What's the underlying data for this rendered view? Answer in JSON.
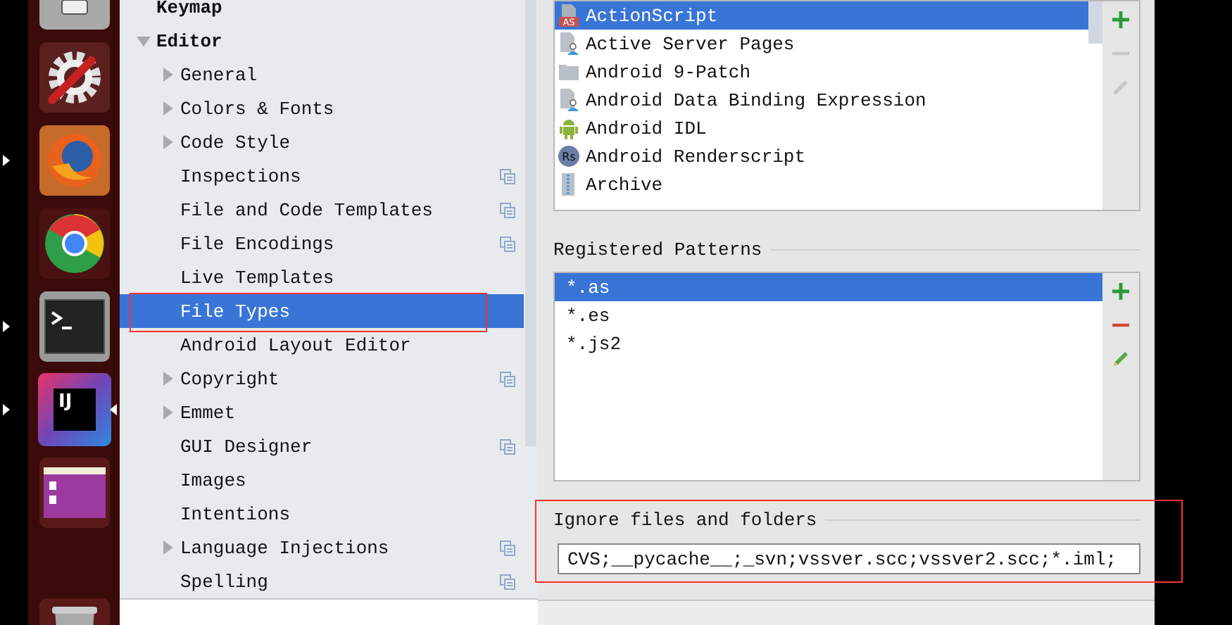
{
  "dock": {
    "items": [
      {
        "kind": "drawer",
        "running": false,
        "focused": false
      },
      {
        "kind": "settings",
        "running": false,
        "focused": false
      },
      {
        "kind": "firefox",
        "running": true,
        "focused": false
      },
      {
        "kind": "chrome",
        "running": false,
        "focused": false
      },
      {
        "kind": "terminal",
        "running": true,
        "focused": false
      },
      {
        "kind": "ide",
        "logo_text": "IJ",
        "running": true,
        "focused": true
      },
      {
        "kind": "files",
        "running": false,
        "focused": false
      },
      {
        "kind": "trash",
        "running": false,
        "focused": false
      }
    ]
  },
  "settings_tree": {
    "items": [
      {
        "label": "Keymap",
        "kind": "leaf",
        "selected": false,
        "project_scoped": false
      },
      {
        "label": "Editor",
        "kind": "branch",
        "expanded": true,
        "selected": false,
        "project_scoped": false,
        "children": [
          {
            "label": "General",
            "kind": "branch",
            "expanded": false,
            "selected": false,
            "project_scoped": false
          },
          {
            "label": "Colors & Fonts",
            "kind": "branch",
            "expanded": false,
            "selected": false,
            "project_scoped": false
          },
          {
            "label": "Code Style",
            "kind": "branch",
            "expanded": false,
            "selected": false,
            "project_scoped": false
          },
          {
            "label": "Inspections",
            "kind": "leaf",
            "selected": false,
            "project_scoped": true
          },
          {
            "label": "File and Code Templates",
            "kind": "leaf",
            "selected": false,
            "project_scoped": true
          },
          {
            "label": "File Encodings",
            "kind": "leaf",
            "selected": false,
            "project_scoped": true
          },
          {
            "label": "Live Templates",
            "kind": "leaf",
            "selected": false,
            "project_scoped": false
          },
          {
            "label": "File Types",
            "kind": "leaf",
            "selected": true,
            "project_scoped": false
          },
          {
            "label": "Android Layout Editor",
            "kind": "leaf",
            "selected": false,
            "project_scoped": false
          },
          {
            "label": "Copyright",
            "kind": "branch",
            "expanded": false,
            "selected": false,
            "project_scoped": true
          },
          {
            "label": "Emmet",
            "kind": "branch",
            "expanded": false,
            "selected": false,
            "project_scoped": false
          },
          {
            "label": "GUI Designer",
            "kind": "leaf",
            "selected": false,
            "project_scoped": true
          },
          {
            "label": "Images",
            "kind": "leaf",
            "selected": false,
            "project_scoped": false
          },
          {
            "label": "Intentions",
            "kind": "leaf",
            "selected": false,
            "project_scoped": false
          },
          {
            "label": "Language Injections",
            "kind": "branch",
            "expanded": false,
            "selected": false,
            "project_scoped": true
          },
          {
            "label": "Spelling",
            "kind": "leaf",
            "selected": false,
            "project_scoped": true
          }
        ]
      }
    ]
  },
  "recognized_file_types": {
    "items": [
      {
        "label": "ActionScript",
        "kind": "badge",
        "icon_text": "AS",
        "selected": true
      },
      {
        "label": "Active Server Pages",
        "kind": "person",
        "selected": false
      },
      {
        "label": "Android 9-Patch",
        "kind": "folder",
        "selected": false
      },
      {
        "label": "Android Data Binding Expression",
        "kind": "person",
        "selected": false
      },
      {
        "label": "Android IDL",
        "kind": "robot",
        "selected": false
      },
      {
        "label": "Android Renderscript",
        "kind": "round",
        "icon_text": "Rs",
        "selected": false
      },
      {
        "label": "Archive",
        "kind": "zip",
        "selected": false
      }
    ],
    "buttons": [
      {
        "kind": "add",
        "disabled": false
      },
      {
        "kind": "remove",
        "disabled": true
      },
      {
        "kind": "edit",
        "disabled": true
      }
    ]
  },
  "registered_patterns": {
    "title": "Registered Patterns",
    "items": [
      {
        "label": "*.as",
        "selected": true
      },
      {
        "label": "*.es",
        "selected": false
      },
      {
        "label": "*.js2",
        "selected": false
      }
    ],
    "buttons": [
      {
        "kind": "add",
        "disabled": false
      },
      {
        "kind": "remove",
        "disabled": false
      },
      {
        "kind": "edit",
        "disabled": false
      }
    ]
  },
  "ignore_files": {
    "title": "Ignore files and folders",
    "value": "CVS;__pycache__;_svn;vssver.scc;vssver2.scc;*.iml;"
  }
}
